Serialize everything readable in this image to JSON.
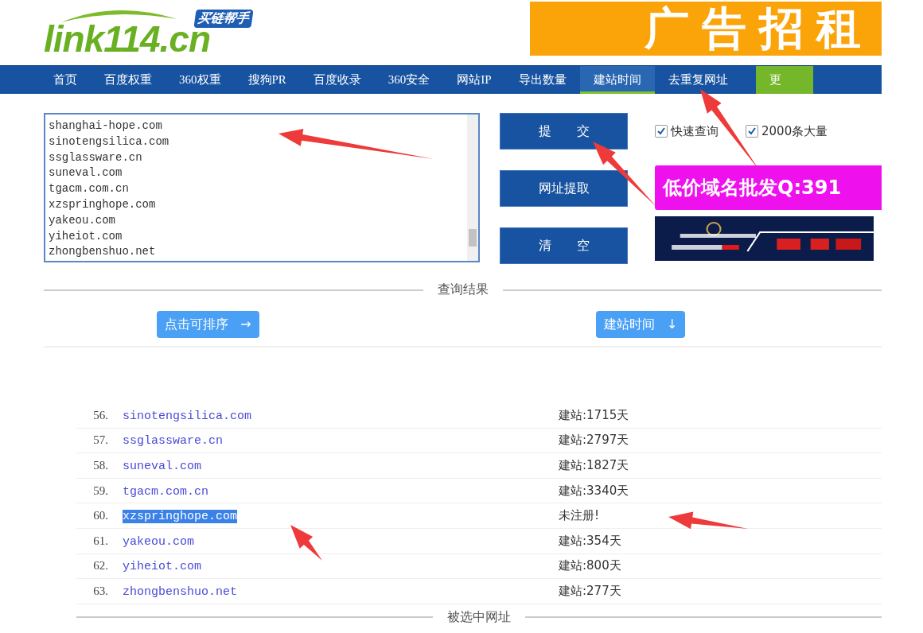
{
  "logo": {
    "text": "link114.cn",
    "badge": "买链帮手"
  },
  "banner": {
    "text": "广告招租"
  },
  "nav": [
    {
      "label": "首页",
      "selected": false,
      "kind": "normal"
    },
    {
      "label": "百度权重",
      "selected": false,
      "kind": "normal"
    },
    {
      "label": "360权重",
      "selected": false,
      "kind": "normal"
    },
    {
      "label": "搜狗PR",
      "selected": false,
      "kind": "normal"
    },
    {
      "label": "百度收录",
      "selected": false,
      "kind": "normal"
    },
    {
      "label": "360安全",
      "selected": false,
      "kind": "normal"
    },
    {
      "label": "网站IP",
      "selected": false,
      "kind": "normal"
    },
    {
      "label": "导出数量",
      "selected": false,
      "kind": "normal"
    },
    {
      "label": "建站时间",
      "selected": true,
      "kind": "normal"
    },
    {
      "label": "去重复网址",
      "selected": false,
      "kind": "normal"
    },
    {
      "label": "更",
      "selected": false,
      "kind": "green"
    }
  ],
  "input": {
    "lines": [
      "shanghai-hope.com",
      "sinotengsilica.com",
      "ssglassware.cn",
      "suneval.com",
      "tgacm.com.cn",
      "xzspringhope.com",
      "yakeou.com",
      "yiheiot.com",
      "zhongbenshuo.net"
    ]
  },
  "buttons": [
    "提　　交",
    "网址提取",
    "清　　空"
  ],
  "options": [
    {
      "label": "快速查询",
      "checked": true
    },
    {
      "label": "2000条大量",
      "checked": true
    }
  ],
  "ads": [
    {
      "kind": "text",
      "text": "低价域名批发Q:391"
    },
    {
      "kind": "picture"
    }
  ],
  "results_title": "查询结果",
  "sort_buttons": [
    {
      "label": "点击可排序",
      "icon": "→"
    },
    {
      "label": "建站时间",
      "icon": "↓"
    }
  ],
  "rows": [
    {
      "index": "56.",
      "domain": "sinotengsilica.com",
      "age": "建站:1715天",
      "selected": false
    },
    {
      "index": "57.",
      "domain": "ssglassware.cn",
      "age": "建站:2797天",
      "selected": false
    },
    {
      "index": "58.",
      "domain": "suneval.com",
      "age": "建站:1827天",
      "selected": false
    },
    {
      "index": "59.",
      "domain": "tgacm.com.cn",
      "age": "建站:3340天",
      "selected": false
    },
    {
      "index": "60.",
      "domain": "xzspringhope.com",
      "age": "未注册!",
      "selected": true
    },
    {
      "index": "61.",
      "domain": "yakeou.com",
      "age": "建站:354天",
      "selected": false
    },
    {
      "index": "62.",
      "domain": "yiheiot.com",
      "age": "建站:800天",
      "selected": false
    },
    {
      "index": "63.",
      "domain": "zhongbenshuo.net",
      "age": "建站:277天",
      "selected": false
    }
  ],
  "selected_title": "被选中网址"
}
